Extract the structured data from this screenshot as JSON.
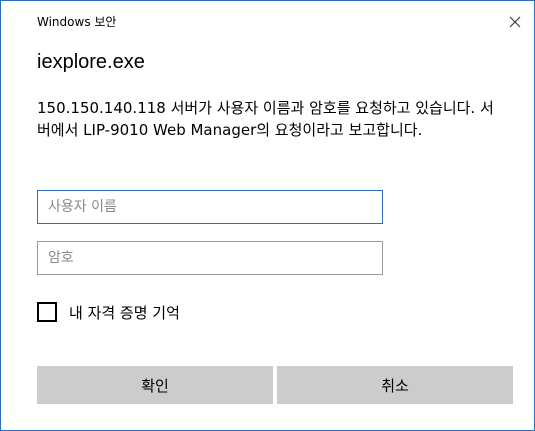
{
  "window": {
    "title": "Windows 보안",
    "close_icon": "close-icon"
  },
  "app_name": "iexplore.exe",
  "message": "150.150.140.118 서버가 사용자 이름과 암호를 요청하고 있습니다. 서버에서 LIP-9010 Web Manager의 요청이라고 보고합니다.",
  "username": {
    "placeholder": "사용자 이름",
    "value": ""
  },
  "password": {
    "placeholder": "암호",
    "value": ""
  },
  "remember": {
    "label": "내 자격 증명 기억",
    "checked": false
  },
  "buttons": {
    "ok_label": "확인",
    "cancel_label": "취소"
  },
  "colors": {
    "accent": "#2b6fc2",
    "button_bg": "#cccccc"
  }
}
